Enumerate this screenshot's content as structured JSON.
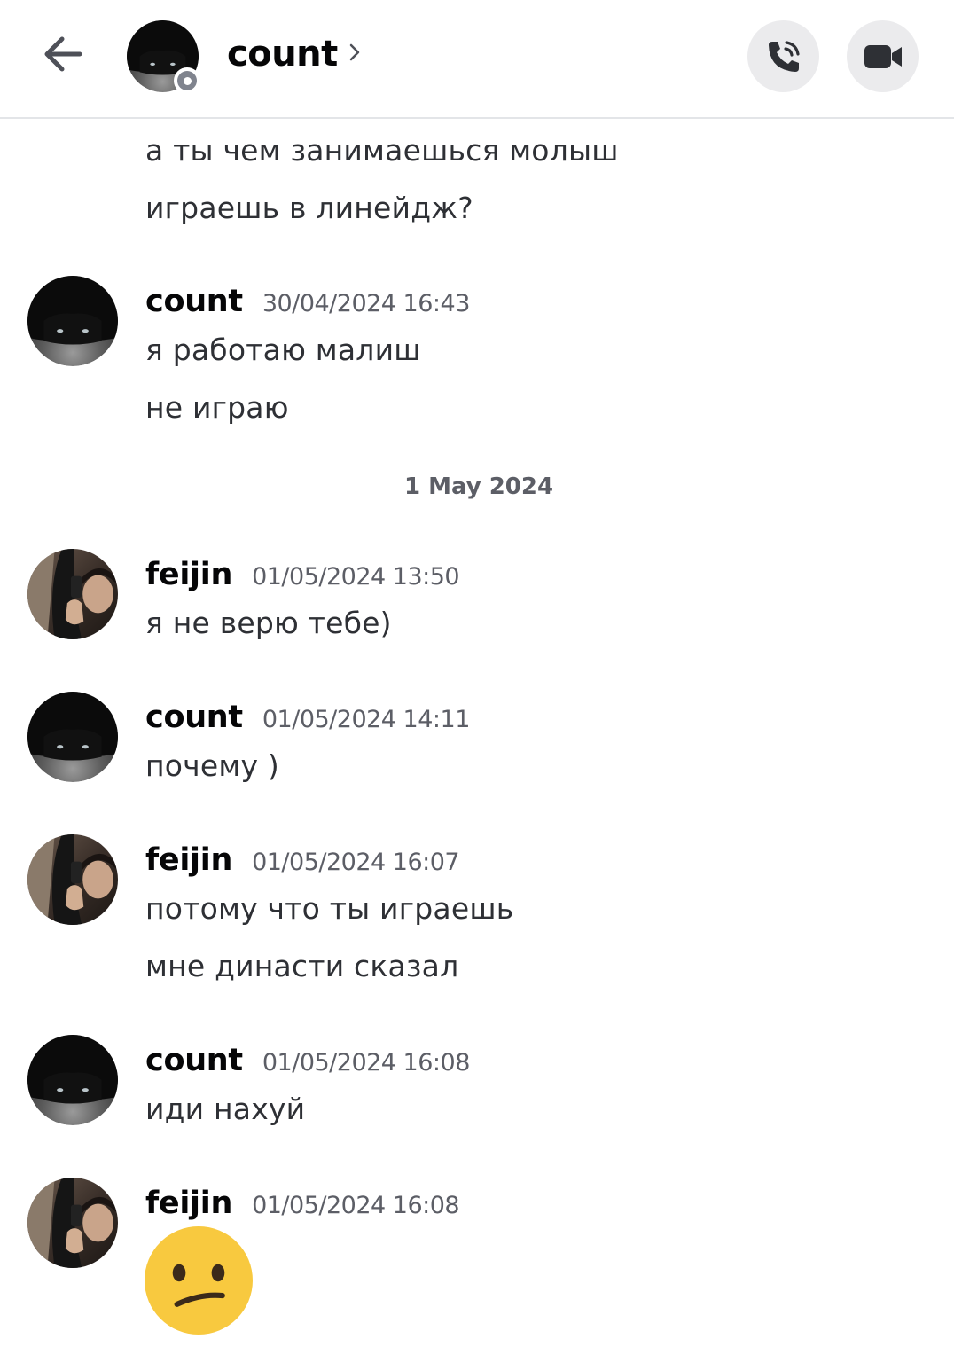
{
  "header": {
    "title": "count",
    "back_icon": "arrow-left-icon",
    "call_icon": "phone-call-icon",
    "video_icon": "video-camera-icon",
    "status": "offline"
  },
  "messages_top": [
    "а ты чем занимаешься молыш",
    "играешь в линейдж?"
  ],
  "groups": [
    {
      "author": "count",
      "timestamp": "30/04/2024 16:43",
      "lines": [
        "я работаю малиш",
        "не играю"
      ]
    },
    {
      "author": "feijin",
      "timestamp": "01/05/2024 13:50",
      "lines": [
        "я не верю тебе)"
      ]
    },
    {
      "author": "count",
      "timestamp": "01/05/2024 14:11",
      "lines": [
        "почему )"
      ]
    },
    {
      "author": "feijin",
      "timestamp": "01/05/2024 16:07",
      "lines": [
        "потому что ты играешь",
        "мне династи сказал"
      ]
    },
    {
      "author": "count",
      "timestamp": "01/05/2024 16:08",
      "lines": [
        "иди нахуй"
      ]
    },
    {
      "author": "feijin",
      "timestamp": "01/05/2024 16:08",
      "emoji": "confused-face-emoji"
    }
  ],
  "date_divider": "1 May 2024",
  "colors": {
    "header_button_bg": "#ebebed",
    "timestamp": "#5c5e66",
    "divider": "#c4c9ce",
    "status_offline": "#80848e",
    "emoji_yellow": "#f8c93f"
  }
}
